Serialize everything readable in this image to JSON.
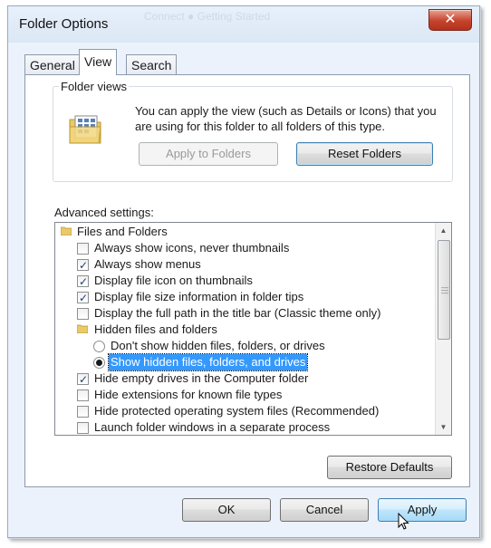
{
  "window": {
    "title": "Folder Options",
    "close_glyph": "✕",
    "background_text": "Connect ● Getting Started"
  },
  "tabs": [
    {
      "label": "General",
      "active": false
    },
    {
      "label": "View",
      "active": true
    },
    {
      "label": "Search",
      "active": false
    }
  ],
  "folder_views": {
    "legend": "Folder views",
    "description": "You can apply the view (such as Details or Icons) that you are using for this folder to all folders of this type.",
    "apply_to_folders": "Apply to Folders",
    "reset_folders": "Reset Folders",
    "icon": "folder-view-icon"
  },
  "advanced": {
    "label": "Advanced settings:",
    "items": [
      {
        "type": "folder",
        "text": "Files and Folders"
      },
      {
        "type": "checkbox",
        "text": "Always show icons, never thumbnails",
        "checked": false
      },
      {
        "type": "checkbox",
        "text": "Always show menus",
        "checked": true
      },
      {
        "type": "checkbox",
        "text": "Display file icon on thumbnails",
        "checked": true
      },
      {
        "type": "checkbox",
        "text": "Display file size information in folder tips",
        "checked": true
      },
      {
        "type": "checkbox",
        "text": "Display the full path in the title bar (Classic theme only)",
        "checked": false
      },
      {
        "type": "folder",
        "text": "Hidden files and folders"
      },
      {
        "type": "radio",
        "text": "Don't show hidden files, folders, or drives",
        "checked": false
      },
      {
        "type": "radio",
        "text": "Show hidden files, folders, and drives",
        "checked": true,
        "selected": true
      },
      {
        "type": "checkbox",
        "text": "Hide empty drives in the Computer folder",
        "checked": true
      },
      {
        "type": "checkbox",
        "text": "Hide extensions for known file types",
        "checked": false
      },
      {
        "type": "checkbox",
        "text": "Hide protected operating system files (Recommended)",
        "checked": false
      },
      {
        "type": "checkbox",
        "text": "Launch folder windows in a separate process",
        "checked": false
      }
    ],
    "check_glyph": "✓"
  },
  "buttons": {
    "restore_defaults": "Restore Defaults",
    "ok": "OK",
    "cancel": "Cancel",
    "apply": "Apply"
  },
  "colors": {
    "selection": "#3399ff",
    "window_bg": "#ebf2fb",
    "close_button": "#c5432d"
  }
}
